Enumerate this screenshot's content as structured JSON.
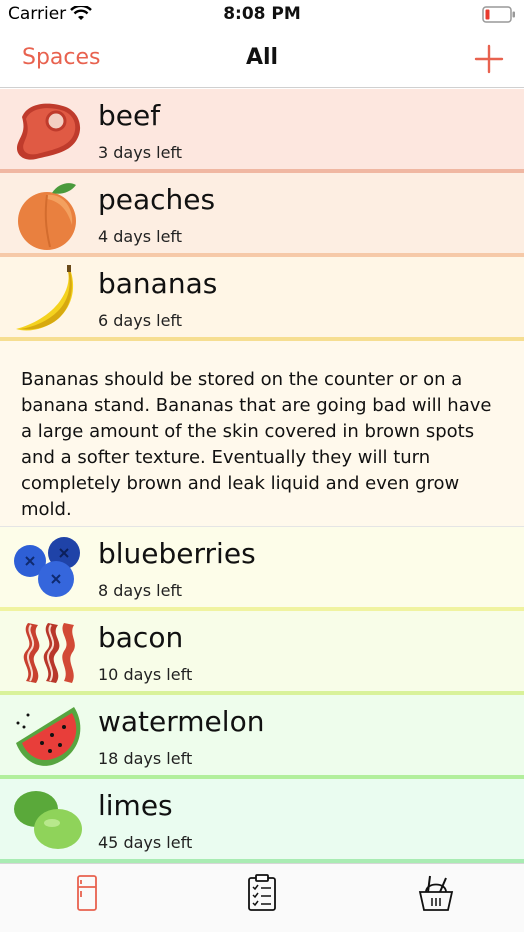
{
  "status": {
    "carrier": "Carrier",
    "time": "8:08 PM"
  },
  "nav": {
    "left": "Spaces",
    "title": "All",
    "add_icon": "plus-icon"
  },
  "items": [
    {
      "name": "beef",
      "sub": "3 days left",
      "icon": "steak-icon",
      "bg": "#fde7df",
      "border": "#f0b7a2"
    },
    {
      "name": "peaches",
      "sub": "4 days left",
      "icon": "peach-icon",
      "bg": "#fdeee2",
      "border": "#f6c9a8"
    },
    {
      "name": "bananas",
      "sub": "6 days left",
      "icon": "banana-icon",
      "bg": "#fff6e6",
      "border": "#f6de91"
    },
    {
      "name": "blueberries",
      "sub": "8 days left",
      "icon": "blueberries-icon",
      "bg": "#fdfde9",
      "border": "#f0f3a0"
    },
    {
      "name": "bacon",
      "sub": "10 days left",
      "icon": "bacon-icon",
      "bg": "#f8fde8",
      "border": "#d9f29a"
    },
    {
      "name": "watermelon",
      "sub": "18 days left",
      "icon": "watermelon-icon",
      "bg": "#eefdec",
      "border": "#b2ef9c"
    },
    {
      "name": "limes",
      "sub": "45 days left",
      "icon": "limes-icon",
      "bg": "#eafcf0",
      "border": "#a9ecb3"
    }
  ],
  "detail": {
    "text": "Bananas should be stored on the counter or on a banana stand.  Bananas that are going bad will have a large amount of the skin covered in brown spots and a softer texture.  Eventually they will turn completely brown and leak liquid and even grow mold."
  },
  "tabs": [
    {
      "icon": "fridge-icon",
      "color": "#e8624f"
    },
    {
      "icon": "checklist-icon",
      "color": "#111111"
    },
    {
      "icon": "basket-icon",
      "color": "#111111"
    }
  ]
}
